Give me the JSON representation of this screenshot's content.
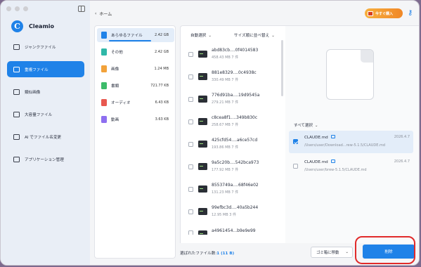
{
  "app": {
    "name": "Cleamio",
    "logo_letter": "C",
    "brand_color": "#1f82e8",
    "icons": {
      "sidebar_toggle": "sidebar-toggle-icon",
      "key": "key-icon",
      "gift": "gift-icon"
    }
  },
  "sidebar": {
    "items": [
      {
        "label": "ジャンクファイル",
        "icon": "broom-icon",
        "active": false
      },
      {
        "label": "重複ファイル",
        "icon": "duplicate-files-icon",
        "active": true
      },
      {
        "label": "類似画像",
        "icon": "image-icon",
        "active": false
      },
      {
        "label": "大容量ファイル",
        "icon": "large-file-icon",
        "active": false
      },
      {
        "label": "AI でファイル名変更",
        "icon": "ai-rename-icon",
        "active": false
      },
      {
        "label": "アプリケーション管理",
        "icon": "apps-icon",
        "active": false
      }
    ]
  },
  "header": {
    "back_label": "ホーム",
    "promo_label": "今すぐ購入"
  },
  "categories": [
    {
      "label": "あらゆるファイル",
      "size": "2.42 GB",
      "color": "#1f82e8",
      "active": true
    },
    {
      "label": "その他",
      "size": "2.42 GB",
      "color": "#2fb8a8",
      "active": false
    },
    {
      "label": "画像",
      "size": "1.24 MB",
      "color": "#f2a23a",
      "active": false
    },
    {
      "label": "書類",
      "size": "721.77 KB",
      "color": "#3dbb6a",
      "active": false
    },
    {
      "label": "オーディオ",
      "size": "6.43 KB",
      "color": "#e8584f",
      "active": false
    },
    {
      "label": "動画",
      "size": "3.63 KB",
      "color": "#8e6ff0",
      "active": false
    }
  ],
  "filelist": {
    "sort_label": "自動選択",
    "sortby_label": "サイズ順に並べ替え",
    "files": [
      {
        "name": "abd83cb....0f4014583",
        "meta": "458.43 MB  7 件"
      },
      {
        "name": "881e8329....0c4938c",
        "meta": "330.49 MB  7 件"
      },
      {
        "name": "776d91ba....19d9545a",
        "meta": "279.21 MB  7 件"
      },
      {
        "name": "c8cea8f1....349b830c",
        "meta": "258.67 MB  7 件"
      },
      {
        "name": "425cfd54....a6ce57cd",
        "meta": "193.86 MB  7 件"
      },
      {
        "name": "9a5c20b....542bca973",
        "meta": "177.92 MB  7 件"
      },
      {
        "name": "8553749a....68f46e02",
        "meta": "131.23 MB  7 件"
      },
      {
        "name": "99efbc3d....40a5b244",
        "meta": "12.95 MB  3 件"
      },
      {
        "name": "a4961454...b9e9e99",
        "meta": ""
      }
    ]
  },
  "preview": {
    "select_all_label": "すべて選択",
    "duplicates": [
      {
        "name": "CLAUDE.md",
        "date": "2026.4.7",
        "path": "/Users/user/Download...rew-5.1.5/CLAUDE.md",
        "checked": true
      },
      {
        "name": "CLAUDE.md",
        "date": "2026.4.7",
        "path": "/Users/user/brew-5.1.5/CLAUDE.md",
        "checked": false
      }
    ]
  },
  "footer": {
    "selected_prefix": "選ばれたファイル数:",
    "selected_count": "1 (11 B)",
    "trash_option": "ゴミ箱に移動",
    "delete_label": "削除",
    "highlight_color": "#e12a2a"
  }
}
